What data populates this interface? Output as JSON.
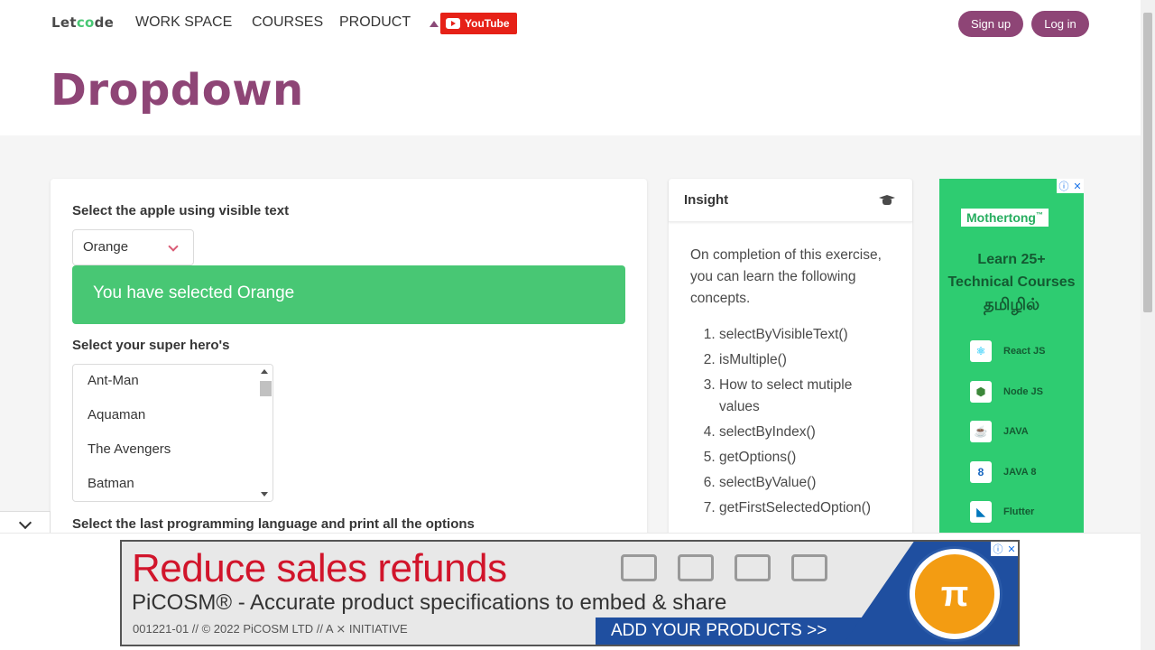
{
  "header": {
    "logo_prefix": "Let",
    "logo_o": "c",
    "logo_suffix": "de",
    "nav": [
      "WORK SPACE",
      "COURSES",
      "PRODUCT"
    ],
    "youtube_label": "YouTube",
    "signup_label": "Sign up",
    "login_label": "Log in"
  },
  "page_title": "Dropdown",
  "exercise": {
    "apple_label": "Select the apple using visible text",
    "apple_selected": "Orange",
    "notice": "You have selected Orange",
    "hero_label": "Select your super hero's",
    "heroes": [
      "Ant-Man",
      "Aquaman",
      "The Avengers",
      "Batman"
    ],
    "lang_label": "Select the last programming language and print all the options"
  },
  "insight": {
    "title": "Insight",
    "intro": "On completion of this exercise, you can learn the following concepts.",
    "items": [
      "selectByVisibleText()",
      "isMultiple()",
      "How to select mutiple values",
      "selectByIndex()",
      "getOptions()",
      "selectByValue()",
      "getFirstSelectedOption()"
    ]
  },
  "side_ad": {
    "brand": "Mothertong",
    "brand_tm": "™",
    "headline_1": "Learn 25+",
    "headline_2": "Technical Courses",
    "tamil": "தமிழில்",
    "courses": [
      "React JS",
      "Node JS",
      "JAVA",
      "JAVA 8",
      "Flutter"
    ],
    "icon_names": [
      "react-icon",
      "nodejs-icon",
      "java-icon",
      "java8-icon",
      "flutter-icon"
    ]
  },
  "banner_ad": {
    "headline": "Reduce sales refunds",
    "sub": "PiCOSM® - Accurate product specifications to embed & share",
    "small": "001221-01 // © 2022 PiCOSM LTD // A ⨯ INITIATIVE",
    "cta": "ADD YOUR PRODUCTS >>"
  },
  "ad_controls": {
    "info": "ⓘ",
    "close": "✕"
  },
  "colors": {
    "brand": "#8e4576",
    "success": "#48c774",
    "youtube": "#e62117",
    "ad_green": "#2ecc71",
    "banner_red": "#d1152b",
    "banner_blue": "#1f4fa0"
  }
}
